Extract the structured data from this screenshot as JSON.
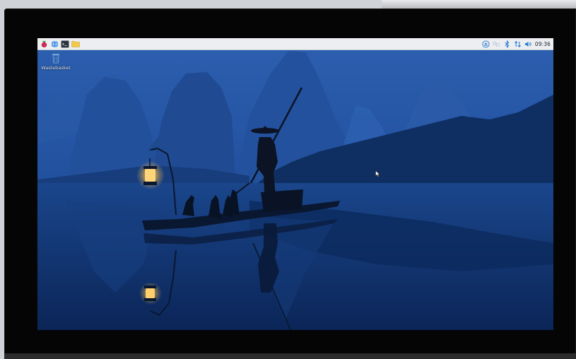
{
  "taskbar": {
    "launchers": [
      {
        "name": "menu",
        "icon": "raspberry-icon"
      },
      {
        "name": "browser",
        "icon": "globe-icon"
      },
      {
        "name": "terminal",
        "icon": "terminal-icon"
      },
      {
        "name": "files",
        "icon": "folder-icon"
      }
    ],
    "tray": [
      {
        "icon": "eject-icon"
      },
      {
        "icon": "vnc-icon"
      },
      {
        "icon": "bluetooth-icon"
      },
      {
        "icon": "network-arrows-icon"
      },
      {
        "icon": "volume-icon"
      }
    ],
    "clock": "09:36"
  },
  "desktop": {
    "icons": [
      {
        "label": "Wastebasket",
        "icon": "trash-icon"
      }
    ]
  },
  "colors": {
    "taskbar_bg": "#eceef1",
    "accent": "#2b7bd1",
    "wallpaper_sky": "#1f52a4",
    "wallpaper_water": "#0c2c63",
    "lantern": "#ffd57a"
  }
}
